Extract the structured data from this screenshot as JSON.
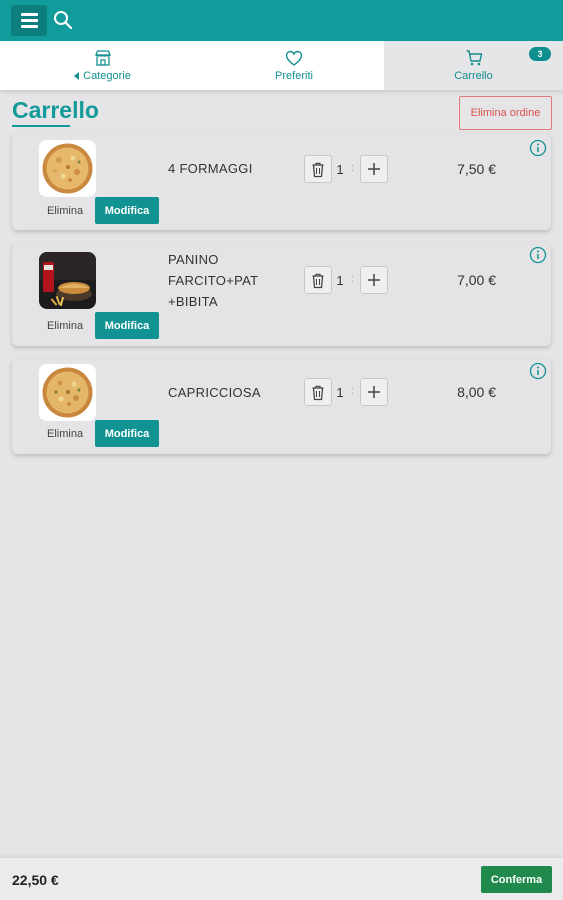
{
  "nav": {
    "categorie_label": "Categorie",
    "preferiti_label": "Preferiti",
    "carrello_label": "Carrello",
    "cart_count": "3"
  },
  "page": {
    "title": "Carrello",
    "clear_order_label": "Elimina ordine"
  },
  "cart_items": [
    {
      "name": "4 FORMAGGI",
      "quantity": "1",
      "price": "7,50 €",
      "remove_label": "Elimina",
      "edit_label": "Modifica",
      "image": "pizza"
    },
    {
      "name": "PANINO FARCITO+PAT +BIBITA",
      "quantity": "1",
      "price": "7,00 €",
      "remove_label": "Elimina",
      "edit_label": "Modifica",
      "image": "panino-menu"
    },
    {
      "name": "CAPRICCIOSA",
      "quantity": "1",
      "price": "8,00 €",
      "remove_label": "Elimina",
      "edit_label": "Modifica",
      "image": "pizza"
    }
  ],
  "qty_separator": ":",
  "footer": {
    "total": "22,50 €",
    "confirm_label": "Conferma"
  },
  "colors": {
    "primary": "#119b9b",
    "confirm": "#1f8a4c",
    "danger": "#d9534f",
    "background": "#e5e4e6"
  },
  "icons": [
    "menu-icon",
    "search-icon",
    "store-icon",
    "heart-icon",
    "cart-icon",
    "trash-icon",
    "plus-icon",
    "info-icon"
  ]
}
